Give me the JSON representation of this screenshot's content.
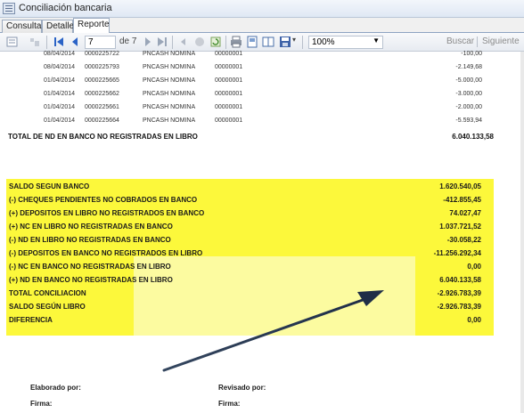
{
  "window": {
    "title": "Conciliación bancaria"
  },
  "tabs": [
    {
      "label": "Consulta",
      "active": false
    },
    {
      "label": "Detalle",
      "active": false
    },
    {
      "label": "Reporte",
      "active": true
    }
  ],
  "toolbar": {
    "page_current": "7",
    "page_of": "de 7",
    "zoom": "100%",
    "search_label": "Buscar",
    "next_label": "Siguiente"
  },
  "detail_rows": [
    {
      "date": "08/04/2014",
      "num": "0000225722",
      "desc": "PNCASH NOMINA",
      "ref": "00000001",
      "amount": "-100,00"
    },
    {
      "date": "08/04/2014",
      "num": "0000225793",
      "desc": "PNCASH NOMINA",
      "ref": "00000001",
      "amount": "-2.149,68"
    },
    {
      "date": "01/04/2014",
      "num": "0000225665",
      "desc": "PNCASH NOMINA",
      "ref": "00000001",
      "amount": "-5.000,00"
    },
    {
      "date": "01/04/2014",
      "num": "0000225662",
      "desc": "PNCASH NOMINA",
      "ref": "00000001",
      "amount": "-3.000,00"
    },
    {
      "date": "01/04/2014",
      "num": "0000225661",
      "desc": "PNCASH NOMINA",
      "ref": "00000001",
      "amount": "-2.000,00"
    },
    {
      "date": "01/04/2014",
      "num": "0000225664",
      "desc": "PNCASH NOMINA",
      "ref": "00000001",
      "amount": "-5.593,94"
    }
  ],
  "total_nd": {
    "label": "TOTAL DE ND EN BANCO NO REGISTRADAS EN LIBRO",
    "value": "6.040.133,58"
  },
  "reconciliation": [
    {
      "label": "SALDO SEGUN BANCO",
      "value": "1.620.540,05"
    },
    {
      "label": "(-) CHEQUES PENDIENTES NO COBRADOS EN BANCO",
      "value": "-412.855,45"
    },
    {
      "label": "(+) DEPOSITOS EN LIBRO NO REGISTRADOS EN BANCO",
      "value": "74.027,47"
    },
    {
      "label": "(+) NC EN LIBRO NO REGISTRADAS EN BANCO",
      "value": "1.037.721,52"
    },
    {
      "label": "(-) ND EN LIBRO NO REGISTRADAS EN BANCO",
      "value": "-30.058,22"
    },
    {
      "label": "(-) DEPOSITOS EN BANCO NO REGISTRADOS EN LIBRO",
      "value": "-11.256.292,34"
    },
    {
      "label": "(-) NC EN BANCO NO REGISTRADAS EN LIBRO",
      "value": "0,00"
    },
    {
      "label": "(+) ND EN BANCO NO REGISTRADAS EN LIBRO",
      "value": "6.040.133,58"
    },
    {
      "label": "TOTAL CONCILIACION",
      "value": "-2.926.783,39"
    },
    {
      "label": "SALDO SEGÚN LIBRO",
      "value": "-2.926.783,39"
    },
    {
      "label": "DIFERENCIA",
      "value": "0,00"
    }
  ],
  "signatures": {
    "prepared_by": "Elaborado por:",
    "reviewed_by": "Revisado por:",
    "signature_left": "Firma:",
    "signature_right": "Firma:"
  },
  "colors": {
    "highlight": "#fcf83b",
    "highlight_pale": "#fcfba0",
    "arrow": "#2c3e5e"
  }
}
